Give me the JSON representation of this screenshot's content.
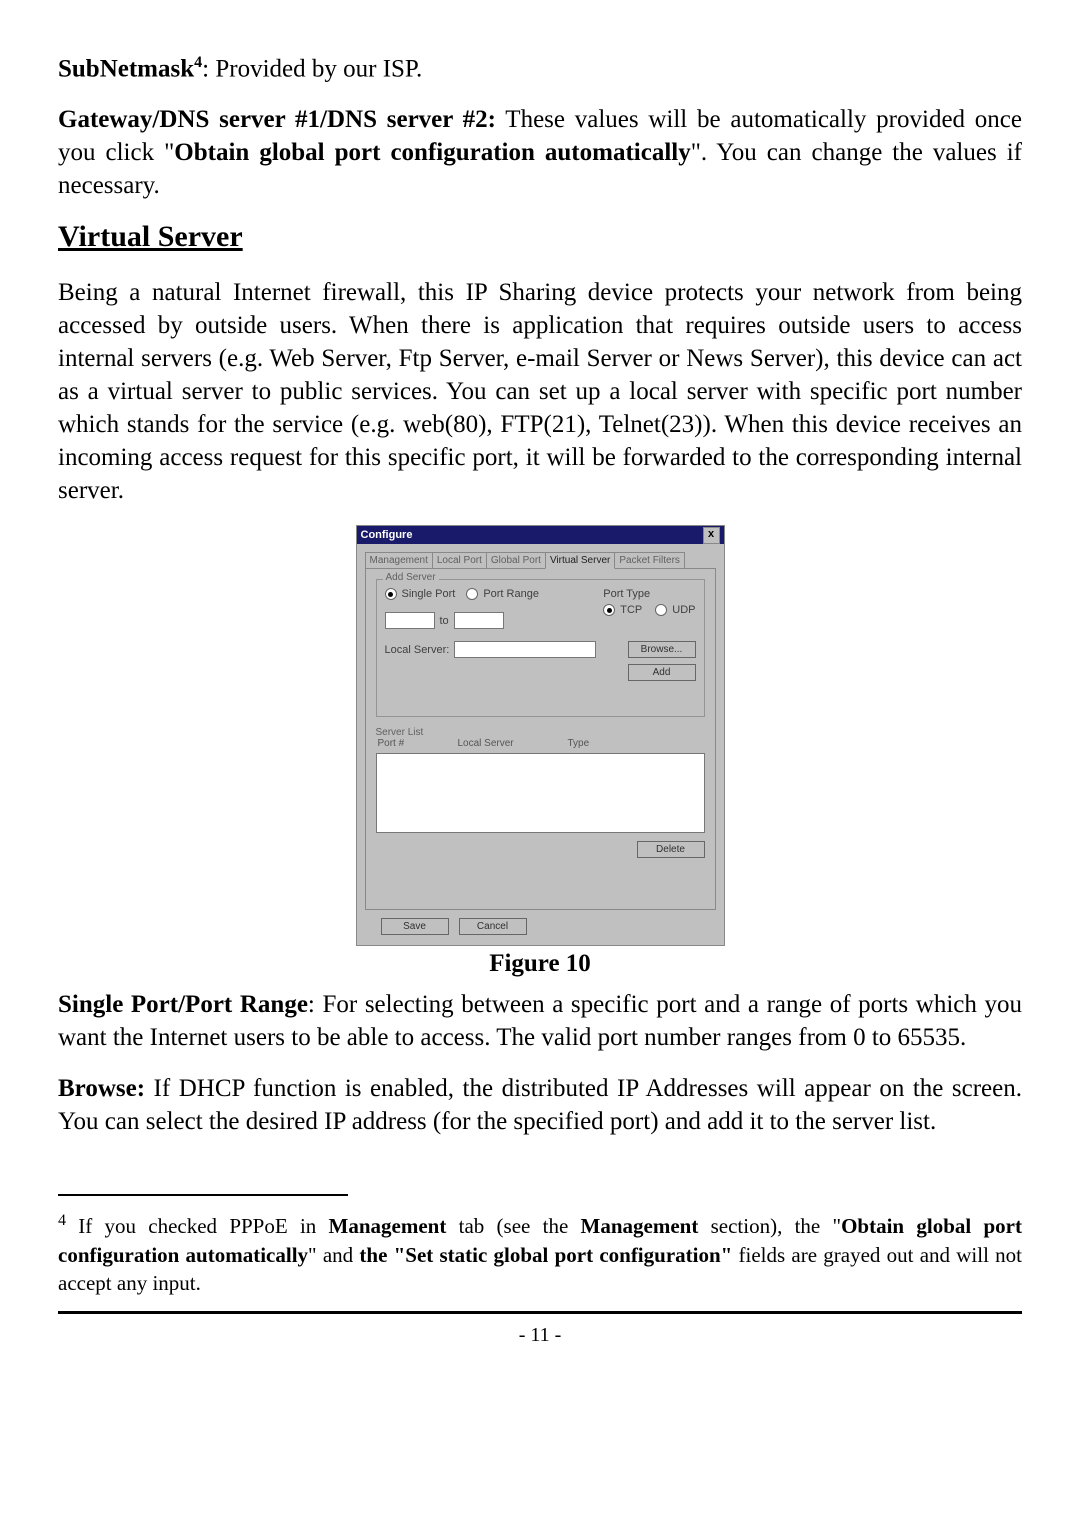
{
  "p1": {
    "a": "SubNetmask",
    "sup": "4",
    "b": ": Provided by our ISP."
  },
  "p2": {
    "a": "Gateway/DNS server #1/DNS server #2:",
    "b": " These values will be automatically provided once you click \"",
    "c": "Obtain global port configuration automatically",
    "d": "\". You can change the values if necessary."
  },
  "h2": "Virtual Server",
  "p3": "Being a natural Internet firewall, this IP Sharing device protects your network from being accessed by outside users. When there is application that requires outside users to access internal servers (e.g. Web Server, Ftp Server, e-mail Server or News Server), this device can act as a virtual server to public services. You can set up a local server with specific port number which stands for the service (e.g. web(80), FTP(21), Telnet(23)). When this device receives an incoming access request for this specific port, it will be forwarded to the corresponding internal server.",
  "figCaption": "Figure 10",
  "p4": {
    "a": "Single Port/Port Range",
    "b": ": For selecting between a specific port and a range of ports which you want the Internet users to be able to access. The valid port number ranges from 0 to 65535."
  },
  "p5": {
    "a": "Browse:",
    "b": " If DHCP function is enabled, the distributed IP Addresses will appear on the screen. You can select the desired IP address (for the specified port) and add it to the server list."
  },
  "footnote": {
    "sup": "4",
    "a": " If you checked PPPoE in ",
    "b": "Management",
    "c": " tab (see the ",
    "d": "Management",
    "e": " section), the \"",
    "f": "Obtain global port configuration automatically",
    "g": "\" and ",
    "h": "the \"Set static global port configuration\"",
    "i": " fields are grayed out and will not accept any input."
  },
  "pageNum": "- 11 -",
  "dlg": {
    "title": "Configure",
    "close": "x",
    "tabs": {
      "t1": "Management",
      "t2": "Local Port",
      "t3": "Global Port",
      "t4": "Virtual Server",
      "t5": "Packet Filters"
    },
    "grpAdd": "Add Server",
    "singlePort": "Single Port",
    "portRange": "Port Range",
    "to": "to",
    "portType": "Port Type",
    "tcp": "TCP",
    "udp": "UDP",
    "localServer": "Local Server:",
    "browse": "Browse...",
    "add": "Add",
    "serverList": "Server List",
    "colPort": "Port #",
    "colLocal": "Local Server",
    "colType": "Type",
    "delete": "Delete",
    "save": "Save",
    "cancel": "Cancel"
  }
}
